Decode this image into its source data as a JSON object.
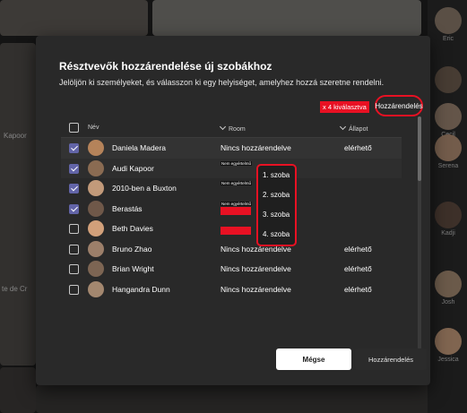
{
  "background": {
    "left_label": "Kapoor",
    "left_bottom_label": "te de Cr",
    "strip": [
      {
        "name": "Eric"
      },
      {
        "name": ""
      },
      {
        "name": "Cecil"
      },
      {
        "name": "Serena"
      },
      {
        "name": "Kadji"
      },
      {
        "name": "Josh"
      },
      {
        "name": "Jessica"
      }
    ]
  },
  "dialog": {
    "title": "Résztvevők hozzárendelése új szobákhoz",
    "subtitle": "Jelöljön ki személyeket, és válasszon ki egy helyiséget, amelyhez hozzá szeretne rendelni.",
    "selected_info": "x 4 kiválasztva",
    "assign_top_label": "Hozzárendelés",
    "columns": {
      "name": "Név",
      "room": "Room",
      "status": "Állapot"
    },
    "rows": [
      {
        "name": "Daniela Madera",
        "room": "Nincs hozzárendelve",
        "status": "elérhető",
        "checked": true,
        "avatar_color": "#b5835a"
      },
      {
        "name": "Audi Kapoor",
        "room": "Nem egyértelmű",
        "status": "",
        "checked": true,
        "avatar_color": "#8a6b52"
      },
      {
        "name": "2010-ben a Buxton",
        "room": "Nem egyértelmű",
        "status": "",
        "checked": true,
        "avatar_color": "#c29a7a"
      },
      {
        "name": "Berastás",
        "room": "Nem egyértelmű",
        "status": "",
        "checked": true,
        "avatar_color": "#6f5849"
      },
      {
        "name": "Beth Davies",
        "room": "",
        "status": "",
        "checked": false,
        "avatar_color": "#d2a07a"
      },
      {
        "name": "Bruno Zhao",
        "room": "Nincs hozzárendelve",
        "status": "elérhető",
        "checked": false,
        "avatar_color": "#9c7f6a"
      },
      {
        "name": "Brian Wright",
        "room": "Nincs hozzárendelve",
        "status": "elérhető",
        "checked": false,
        "avatar_color": "#7d6553"
      },
      {
        "name": "Hangandra Dunn",
        "room": "Nincs hozzárendelve",
        "status": "elérhető",
        "checked": false,
        "avatar_color": "#a3876f"
      }
    ],
    "room_menu": [
      "1. szoba",
      "2. szoba",
      "3. szoba",
      "4. szoba"
    ],
    "cancel_label": "Mégse",
    "assign_label": "Hozzárendelés"
  }
}
